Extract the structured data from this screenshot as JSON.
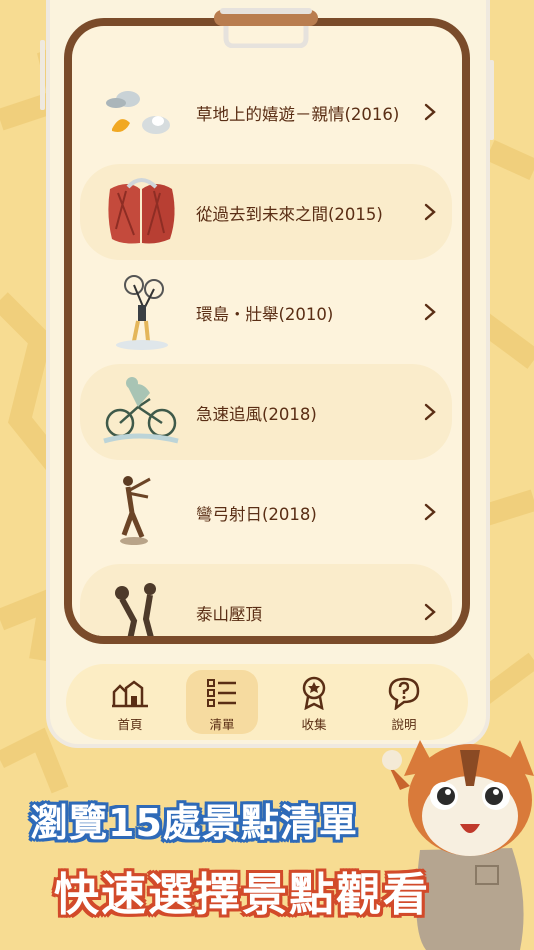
{
  "list": {
    "items": [
      {
        "label": "草地上的嬉遊－親情(2016)"
      },
      {
        "label": "從過去到未來之間(2015)"
      },
      {
        "label": "環島・壯舉(2010)"
      },
      {
        "label": "急速追風(2018)"
      },
      {
        "label": "彎弓射日(2018)"
      },
      {
        "label": "泰山壓頂"
      }
    ]
  },
  "nav": {
    "items": [
      {
        "label": "首頁",
        "icon": "home-buildings-icon"
      },
      {
        "label": "清單",
        "icon": "checklist-icon"
      },
      {
        "label": "收集",
        "icon": "medal-icon"
      },
      {
        "label": "說明",
        "icon": "help-bubble-icon"
      }
    ],
    "active_index": 1
  },
  "promo": {
    "line1": "瀏覽15處景點清單",
    "line2": "快速選擇景點觀看"
  },
  "colors": {
    "background": "#f7dc92",
    "board_frame": "#7a4b2a",
    "text": "#5a2e15",
    "caption1_outline": "#2e6ab8",
    "caption2_outline": "#d24a2a"
  }
}
